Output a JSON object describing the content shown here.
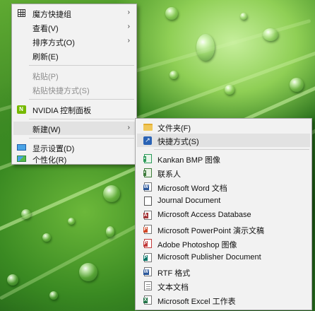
{
  "context_menu": {
    "items": [
      {
        "label": "魔方快捷组",
        "icon": "grid-icon",
        "has_submenu": true,
        "disabled": false
      },
      {
        "label": "查看(V)",
        "icon": "",
        "has_submenu": true,
        "disabled": false
      },
      {
        "label": "排序方式(O)",
        "icon": "",
        "has_submenu": true,
        "disabled": false
      },
      {
        "label": "刷新(E)",
        "icon": "",
        "has_submenu": false,
        "disabled": false
      },
      {
        "label": "粘贴(P)",
        "icon": "",
        "has_submenu": false,
        "disabled": true
      },
      {
        "label": "粘贴快捷方式(S)",
        "icon": "",
        "has_submenu": false,
        "disabled": true
      },
      {
        "label": "NVIDIA 控制面板",
        "icon": "nvidia-icon",
        "has_submenu": false,
        "disabled": false
      },
      {
        "label": "新建(W)",
        "icon": "",
        "has_submenu": true,
        "disabled": false,
        "highlighted": true
      },
      {
        "label": "显示设置(D)",
        "icon": "display-settings-icon",
        "has_submenu": false,
        "disabled": false
      },
      {
        "label": "个性化(R)",
        "icon": "personalize-icon",
        "has_submenu": false,
        "disabled": false
      }
    ]
  },
  "new_submenu": {
    "items": [
      {
        "label": "文件夹(F)",
        "icon": "folder-icon"
      },
      {
        "label": "快捷方式(S)",
        "icon": "shortcut-icon",
        "highlighted": true
      },
      {
        "label": "Kankan BMP 图像",
        "icon": "bmp-image-icon"
      },
      {
        "label": "联系人",
        "icon": "contact-icon"
      },
      {
        "label": "Microsoft Word 文档",
        "icon": "word-icon"
      },
      {
        "label": "Journal Document",
        "icon": "journal-icon"
      },
      {
        "label": "Microsoft Access Database",
        "icon": "access-icon"
      },
      {
        "label": "Microsoft PowerPoint 演示文稿",
        "icon": "powerpoint-icon"
      },
      {
        "label": "Adobe Photoshop 图像",
        "icon": "photoshop-icon"
      },
      {
        "label": "Microsoft Publisher Document",
        "icon": "publisher-icon"
      },
      {
        "label": "RTF 格式",
        "icon": "rtf-icon"
      },
      {
        "label": "文本文档",
        "icon": "text-document-icon"
      },
      {
        "label": "Microsoft Excel 工作表",
        "icon": "excel-icon"
      }
    ]
  },
  "colors": {
    "menu_background": "#f2f2f2",
    "highlight": "#e2e2e2",
    "disabled_text": "#8d8d8d",
    "nvidia_green": "#76b900",
    "word_blue": "#2b579a",
    "access_red": "#a4373a",
    "powerpoint_orange": "#d24726",
    "photoshop_blue": "#31a8ff",
    "publisher_teal": "#077568",
    "excel_green": "#217346"
  },
  "icons": {
    "submenu_arrow": "›",
    "shortcut_glyph": "↗",
    "nvidia_glyph": "N"
  }
}
